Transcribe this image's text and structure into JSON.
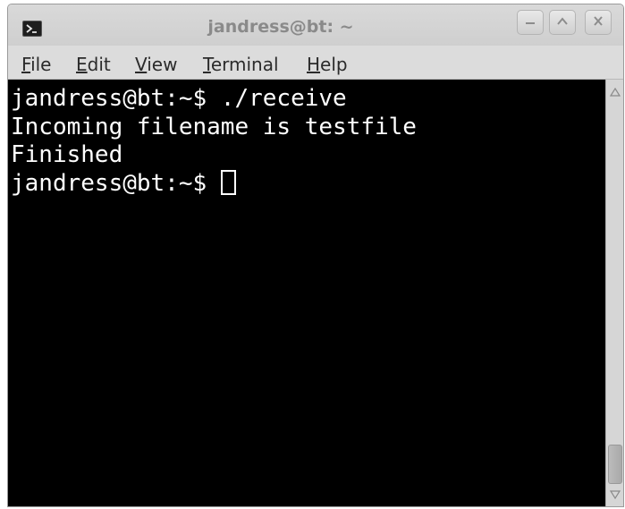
{
  "window": {
    "title": "jandress@bt: ~"
  },
  "menu": {
    "items": [
      {
        "mnemonic": "F",
        "rest": "ile"
      },
      {
        "mnemonic": "E",
        "rest": "dit"
      },
      {
        "mnemonic": "V",
        "rest": "iew"
      },
      {
        "mnemonic": "T",
        "rest": "erminal"
      },
      {
        "mnemonic": "H",
        "rest": "elp"
      }
    ]
  },
  "terminal": {
    "lines": [
      "jandress@bt:~$ ./receive",
      "Incoming filename is testfile",
      "Finished"
    ],
    "prompt": "jandress@bt:~$ "
  },
  "colors": {
    "terminal_bg": "#000000",
    "terminal_fg": "#ffffff",
    "title_text": "#8a8a8a"
  },
  "icons": {
    "window": "terminal-icon",
    "minimize": "minimize-icon",
    "maximize": "maximize-icon",
    "close": "close-icon",
    "scroll_up": "scroll-up-icon",
    "scroll_down": "scroll-down-icon"
  }
}
